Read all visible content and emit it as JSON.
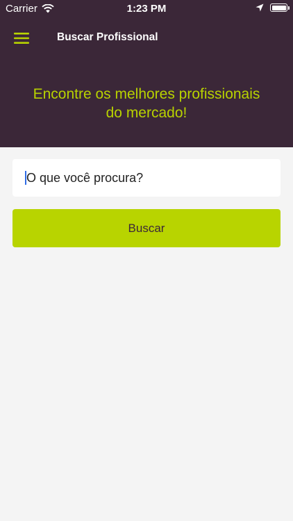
{
  "status_bar": {
    "carrier": "Carrier",
    "time": "1:23 PM",
    "battery_level": 1.0
  },
  "nav": {
    "title": "Buscar Profissional",
    "menu_icon": "hamburger-menu-icon"
  },
  "hero": {
    "headline_line1": "Encontre os melhores profissionais",
    "headline_line2": "do mercado!"
  },
  "search": {
    "placeholder": "O que você procura?",
    "value": "",
    "button_label": "Buscar"
  },
  "colors": {
    "header_bg": "#3b2738",
    "accent": "#b8d400",
    "page_bg": "#f4f4f4",
    "caret": "#2f6ce5"
  }
}
